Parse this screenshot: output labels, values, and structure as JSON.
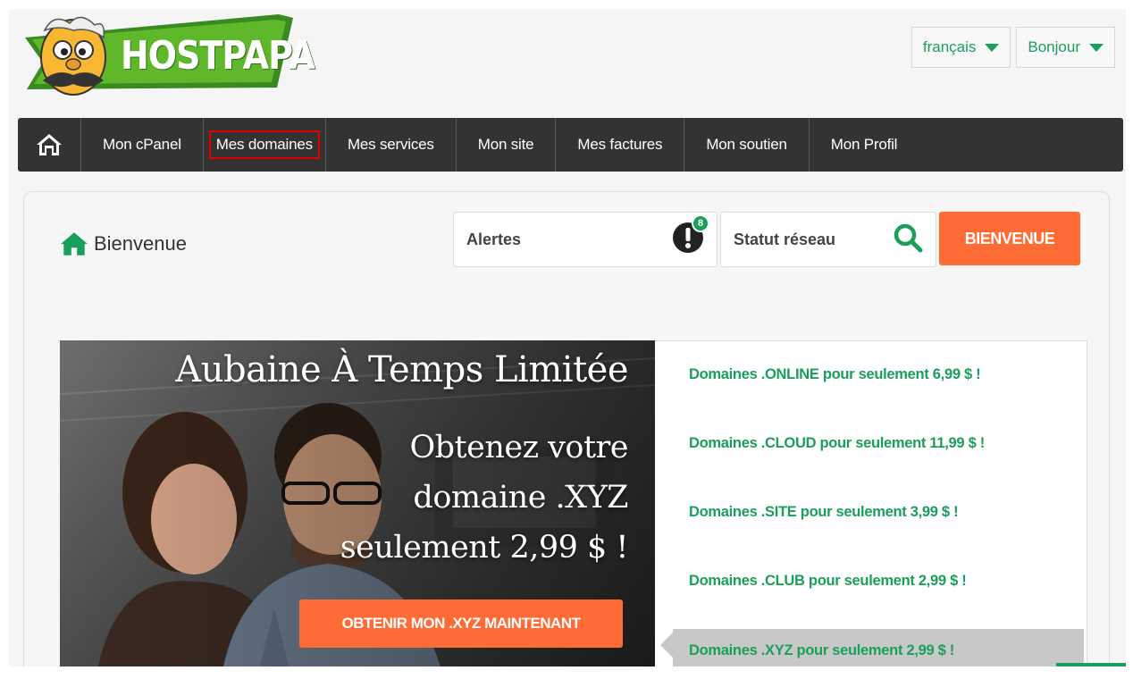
{
  "header": {
    "logo_text": "HOSTPAPA",
    "language_dropdown": "français",
    "user_dropdown": "Bonjour"
  },
  "nav": {
    "items": [
      "Mon cPanel",
      "Mes domaines",
      "Mes services",
      "Mon site",
      "Mes factures",
      "Mon soutien",
      "Mon Profil"
    ]
  },
  "main": {
    "welcome_title": "Bienvenue",
    "alerts_label": "Alertes",
    "alerts_count": "8",
    "network_status_label": "Statut réseau",
    "welcome_button": "BIENVENUE"
  },
  "banner": {
    "title": "Aubaine À Temps Limitée",
    "subtitle": "Obtenez votre domaine .XYZ seulement 2,99 $ !",
    "cta": "OBTENIR MON .XYZ MAINTENANT"
  },
  "promos": [
    "Domaines .ONLINE pour seulement 6,99 $ !",
    "Domaines .CLOUD pour seulement 11,99 $ !",
    "Domaines .SITE pour seulement 3,99 $ !",
    "Domaines .CLUB pour seulement 2,99 $ !",
    "Domaines .XYZ pour seulement 2,99 $ !"
  ],
  "colors": {
    "brand_green": "#1a9f5a",
    "accent_orange": "#ff6b35",
    "nav_bg": "#333333",
    "highlight_red": "#e00000"
  }
}
